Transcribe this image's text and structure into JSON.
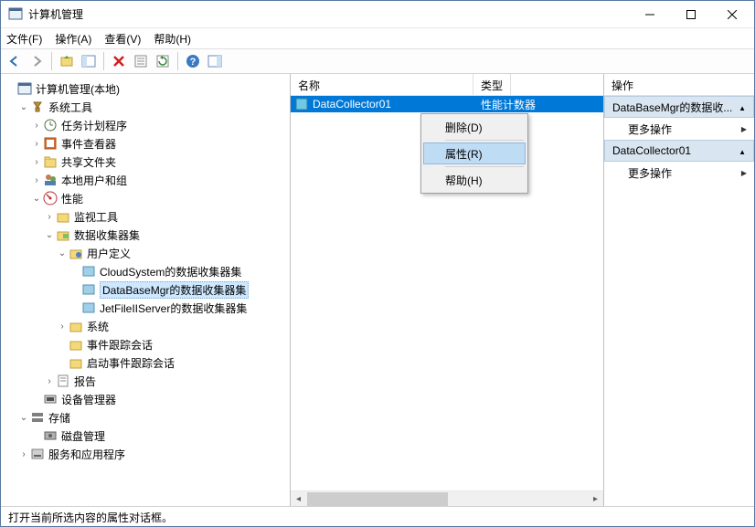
{
  "window": {
    "title": "计算机管理"
  },
  "menu": {
    "file": "文件(F)",
    "action": "操作(A)",
    "view": "查看(V)",
    "help": "帮助(H)"
  },
  "tree": {
    "root": "计算机管理(本地)",
    "system_tools": "系统工具",
    "task_scheduler": "任务计划程序",
    "event_viewer": "事件查看器",
    "shared_folders": "共享文件夹",
    "local_users": "本地用户和组",
    "performance": "性能",
    "monitoring_tools": "监视工具",
    "data_collector_sets": "数据收集器集",
    "user_defined": "用户定义",
    "cloud_system": "CloudSystem的数据收集器集",
    "database_mgr": "DataBaseMgr的数据收集器集",
    "jetfile": "JetFileIIServer的数据收集器集",
    "system": "系统",
    "event_trace": "事件跟踪会话",
    "startup_trace": "启动事件跟踪会话",
    "reports": "报告",
    "device_manager": "设备管理器",
    "storage": "存储",
    "disk_mgmt": "磁盘管理",
    "services_apps": "服务和应用程序"
  },
  "list": {
    "col_name": "名称",
    "col_type": "类型",
    "row1_name": "DataCollector01",
    "row1_type": "性能计数器"
  },
  "context": {
    "delete": "删除(D)",
    "properties": "属性(R)",
    "help": "帮助(H)"
  },
  "actions": {
    "header": "操作",
    "sec1": "DataBaseMgr的数据收...",
    "more1": "更多操作",
    "sec2": "DataCollector01",
    "more2": "更多操作"
  },
  "status": "打开当前所选内容的属性对话框。"
}
